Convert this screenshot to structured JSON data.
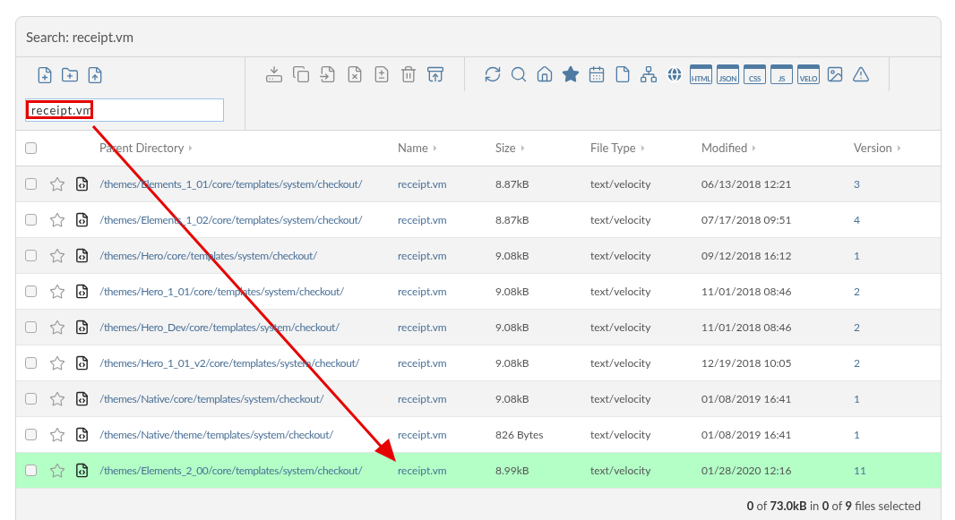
{
  "title": "Search: receipt.vm",
  "search": {
    "value": "receipt.vm"
  },
  "toolbar": {
    "file_type_labels": [
      "HTML",
      "JSON",
      "CSS",
      "JS",
      "VELO"
    ]
  },
  "table": {
    "header_checked": false,
    "columns": [
      "Parent Directory",
      "Name",
      "Size",
      "File Type",
      "Modified",
      "Version"
    ],
    "rows": [
      {
        "path": "/themes/Elements_1_01/core/templates/system/checkout/",
        "name": "receipt.vm",
        "size": "8.87kB",
        "type": "text/velocity",
        "modified": "06/13/2018 12:21",
        "version": "3",
        "checked": false,
        "starred": false,
        "selected": false
      },
      {
        "path": "/themes/Elements_1_02/core/templates/system/checkout/",
        "name": "receipt.vm",
        "size": "8.87kB",
        "type": "text/velocity",
        "modified": "07/17/2018 09:51",
        "version": "4",
        "checked": false,
        "starred": false,
        "selected": false
      },
      {
        "path": "/themes/Hero/core/templates/system/checkout/",
        "name": "receipt.vm",
        "size": "9.08kB",
        "type": "text/velocity",
        "modified": "09/12/2018 16:12",
        "version": "1",
        "checked": false,
        "starred": false,
        "selected": false
      },
      {
        "path": "/themes/Hero_1_01/core/templates/system/checkout/",
        "name": "receipt.vm",
        "size": "9.08kB",
        "type": "text/velocity",
        "modified": "11/01/2018 08:46",
        "version": "2",
        "checked": false,
        "starred": false,
        "selected": false
      },
      {
        "path": "/themes/Hero_Dev/core/templates/system/checkout/",
        "name": "receipt.vm",
        "size": "9.08kB",
        "type": "text/velocity",
        "modified": "11/01/2018 08:46",
        "version": "2",
        "checked": false,
        "starred": false,
        "selected": false
      },
      {
        "path": "/themes/Hero_1_01_v2/core/templates/system/checkout/",
        "name": "receipt.vm",
        "size": "9.08kB",
        "type": "text/velocity",
        "modified": "12/19/2018 10:05",
        "version": "2",
        "checked": false,
        "starred": false,
        "selected": false
      },
      {
        "path": "/themes/Native/core/templates/system/checkout/",
        "name": "receipt.vm",
        "size": "9.08kB",
        "type": "text/velocity",
        "modified": "01/08/2019 16:41",
        "version": "1",
        "checked": false,
        "starred": false,
        "selected": false
      },
      {
        "path": "/themes/Native/theme/templates/system/checkout/",
        "name": "receipt.vm",
        "size": "826 Bytes",
        "type": "text/velocity",
        "modified": "01/08/2019 16:41",
        "version": "1",
        "checked": false,
        "starred": false,
        "selected": false
      },
      {
        "path": "/themes/Elements_2_00/core/templates/system/checkout/",
        "name": "receipt.vm",
        "size": "8.99kB",
        "type": "text/velocity",
        "modified": "01/28/2020 12:16",
        "version": "11",
        "checked": false,
        "starred": false,
        "selected": true
      }
    ]
  },
  "status": "**0** of **73.0kB** in **0** of **9** files selected"
}
